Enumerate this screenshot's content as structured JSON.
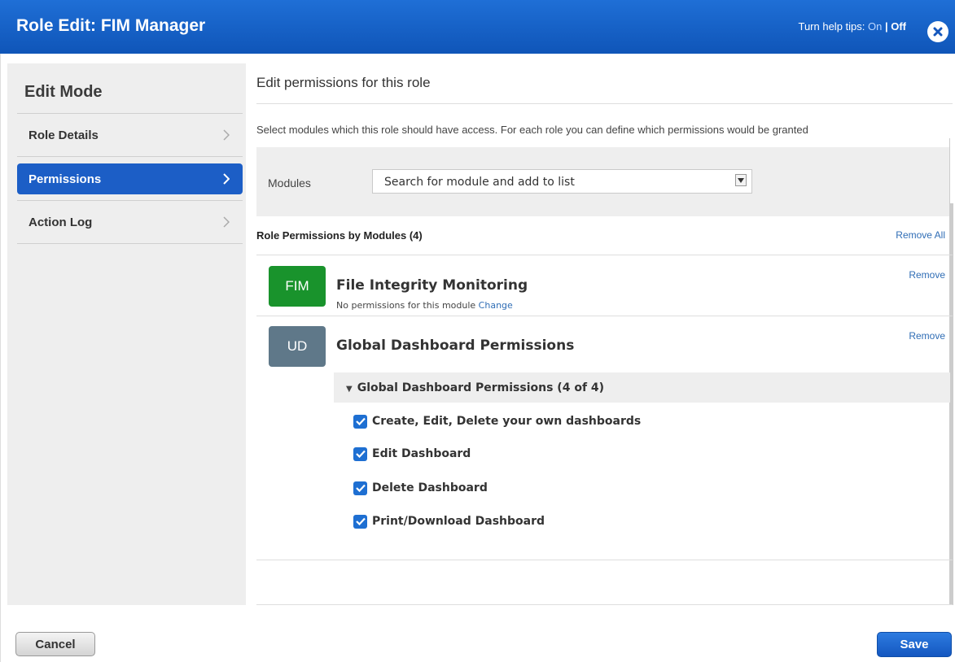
{
  "header": {
    "title": "Role Edit: FIM Manager",
    "help_tips_label": "Turn help tips: ",
    "help_tips_on": "On",
    "help_tips_separator": " | ",
    "help_tips_off": "Off",
    "close_icon": "close-icon"
  },
  "sidebar": {
    "title": "Edit Mode",
    "items": [
      {
        "label": "Role Details",
        "active": false
      },
      {
        "label": "Permissions",
        "active": true
      },
      {
        "label": "Action Log",
        "active": false
      }
    ]
  },
  "main": {
    "title": "Edit permissions for this role",
    "intro": "Select modules which this role should have access. For each role you can define which permissions would be granted",
    "modules_label": "Modules",
    "module_search_placeholder": "Search for module and add to list",
    "permissions_heading": "Role Permissions by Modules (4)",
    "remove_all_label": "Remove All",
    "modules": [
      {
        "badge": "FIM",
        "badge_color": "#19932c",
        "name": "File Integrity Monitoring",
        "sub_text": "No permissions for this module ",
        "change_label": "Change",
        "remove_label": "Remove"
      },
      {
        "badge": "UD",
        "badge_color": "#5f7889",
        "name": "Global Dashboard Permissions",
        "remove_label": "Remove",
        "group": {
          "label": "Global Dashboard Permissions (4 of 4)",
          "expanded": true,
          "permissions": [
            {
              "label": "Create, Edit, Delete your own dashboards",
              "checked": true
            },
            {
              "label": "Edit Dashboard",
              "checked": true
            },
            {
              "label": "Delete Dashboard",
              "checked": true
            },
            {
              "label": "Print/Download Dashboard",
              "checked": true
            }
          ]
        }
      }
    ]
  },
  "footer": {
    "cancel_label": "Cancel",
    "save_label": "Save"
  },
  "colors": {
    "header_blue": "#1462c8",
    "active_nav": "#1c5ec6",
    "link": "#2f6db5",
    "checkbox": "#1e6fd2"
  }
}
